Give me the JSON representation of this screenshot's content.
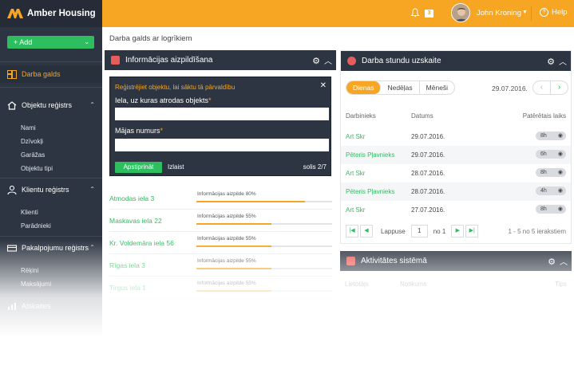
{
  "brand": {
    "name": "Amber Housing"
  },
  "sidebar": {
    "add_label": "+ Add",
    "sections": [
      {
        "label": "Darba galds"
      },
      {
        "label": "Objektu reģistrs",
        "items": [
          "Nami",
          "Dzīvokļi",
          "Garāžas",
          "Objektu tipi"
        ]
      },
      {
        "label": "Klientu reģistrs",
        "items": [
          "Klienti",
          "Parādnieki"
        ]
      },
      {
        "label": "Pakalpojumu reģistrs",
        "items": [
          "Rēķini",
          "Maksājumi"
        ]
      },
      {
        "label": "Atskaites"
      }
    ]
  },
  "topbar": {
    "notifications": "3",
    "user_name": "John Kroning",
    "help_label": "Help"
  },
  "breadcrumb": "Darba galds ar logrīkiem",
  "info_panel": {
    "title": "Informācijas aizpildīšana",
    "dialog": {
      "title": "Reģistrējiet objektu, lai sāktu tā pārvaldību",
      "label1": "Iela, uz kuras atrodas objekts",
      "label2": "Mājas numurs",
      "required": "*",
      "confirm": "Apstiprināt",
      "skip": "Izlaist",
      "step": "solis 2/7"
    },
    "rows": [
      {
        "address": "Atmodas iela 3",
        "progress_text": "Informācijas aizpilde 80%",
        "progress": 0.8
      },
      {
        "address": "Maskavas iela 22",
        "progress_text": "Informācijas aizpilde 55%",
        "progress": 0.55
      },
      {
        "address": "Kr. Voldemāra iela 56",
        "progress_text": "Informācijas aizpilde 55%",
        "progress": 0.55
      },
      {
        "address": "Rīgas iela 3",
        "progress_text": "Informācijas aizpilde 55%",
        "progress": 0.55
      },
      {
        "address": "Tirgus iela 1",
        "progress_text": "Informācijas aizpilde 55%",
        "progress": 0.55
      }
    ]
  },
  "hours_panel": {
    "title": "Darba stundu uzskaite",
    "tabs": [
      "Dienas",
      "Nedēļas",
      "Mēneši"
    ],
    "date": "29.07.2016.",
    "headers": {
      "worker": "Darbinieks",
      "date": "Datums",
      "spent": "Patērētais laiks"
    },
    "rows": [
      {
        "worker": "Art Skr",
        "date": "29.07.2016.",
        "spent": "8h"
      },
      {
        "worker": "Pēteris Pļavnieks",
        "date": "29.07.2016.",
        "spent": "6h"
      },
      {
        "worker": "Art Skr",
        "date": "28.07.2016.",
        "spent": "8h"
      },
      {
        "worker": "Pēteris Pļavnieks",
        "date": "28.07.2016.",
        "spent": "4h"
      },
      {
        "worker": "Art Skr",
        "date": "27.07.2016.",
        "spent": "8h"
      }
    ],
    "pager": {
      "label": "Lappuse",
      "page": "1",
      "of": "no 1",
      "info": "1 - 5 no 5 ierakstiem"
    }
  },
  "activity_panel": {
    "title": "Aktivitātes sistēmā",
    "ghost1": "Lietotājs",
    "ghost2": "Notikums",
    "ghost3": "Tips"
  },
  "colors": {
    "accent": "#f6a623",
    "sidebar": "#2d3542",
    "green": "#2ebd5f"
  }
}
